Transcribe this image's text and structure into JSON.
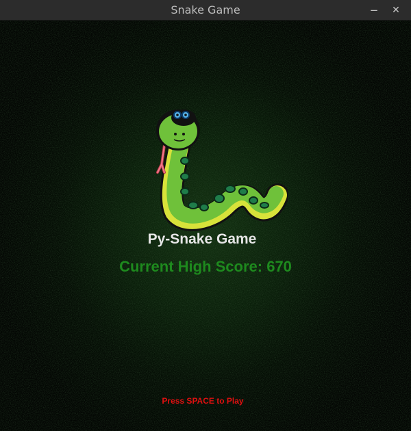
{
  "window": {
    "title": "Snake Game",
    "minimize_glyph": "−",
    "close_glyph": "✕"
  },
  "game": {
    "title": "Py-Snake Game",
    "high_score_label": "Current High Score: 670",
    "prompt": "Press SPACE to Play"
  },
  "colors": {
    "title_text": "#e6e6e6",
    "high_score_text": "#1e8a1e",
    "prompt_text": "#e01010",
    "snake_body": "#6fc13a",
    "snake_spots": "#1f7d4a"
  },
  "icons": {
    "logo": "snake-logo"
  }
}
